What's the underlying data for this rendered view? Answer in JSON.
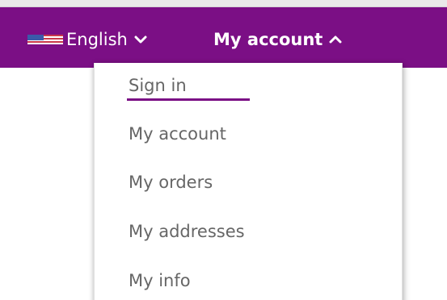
{
  "header": {
    "language": {
      "label": "English",
      "flag_icon": "us-flag-icon",
      "chevron_icon": "chevron-down-icon"
    },
    "account": {
      "label": "My account",
      "chevron_icon": "chevron-up-icon"
    }
  },
  "account_menu": {
    "items": [
      {
        "label": "Sign in",
        "active": true
      },
      {
        "label": "My account"
      },
      {
        "label": "My orders"
      },
      {
        "label": "My addresses"
      },
      {
        "label": "My info"
      }
    ]
  },
  "colors": {
    "brand_purple": "#7b0f85",
    "menu_text": "#666666",
    "header_text": "#ffffff"
  }
}
